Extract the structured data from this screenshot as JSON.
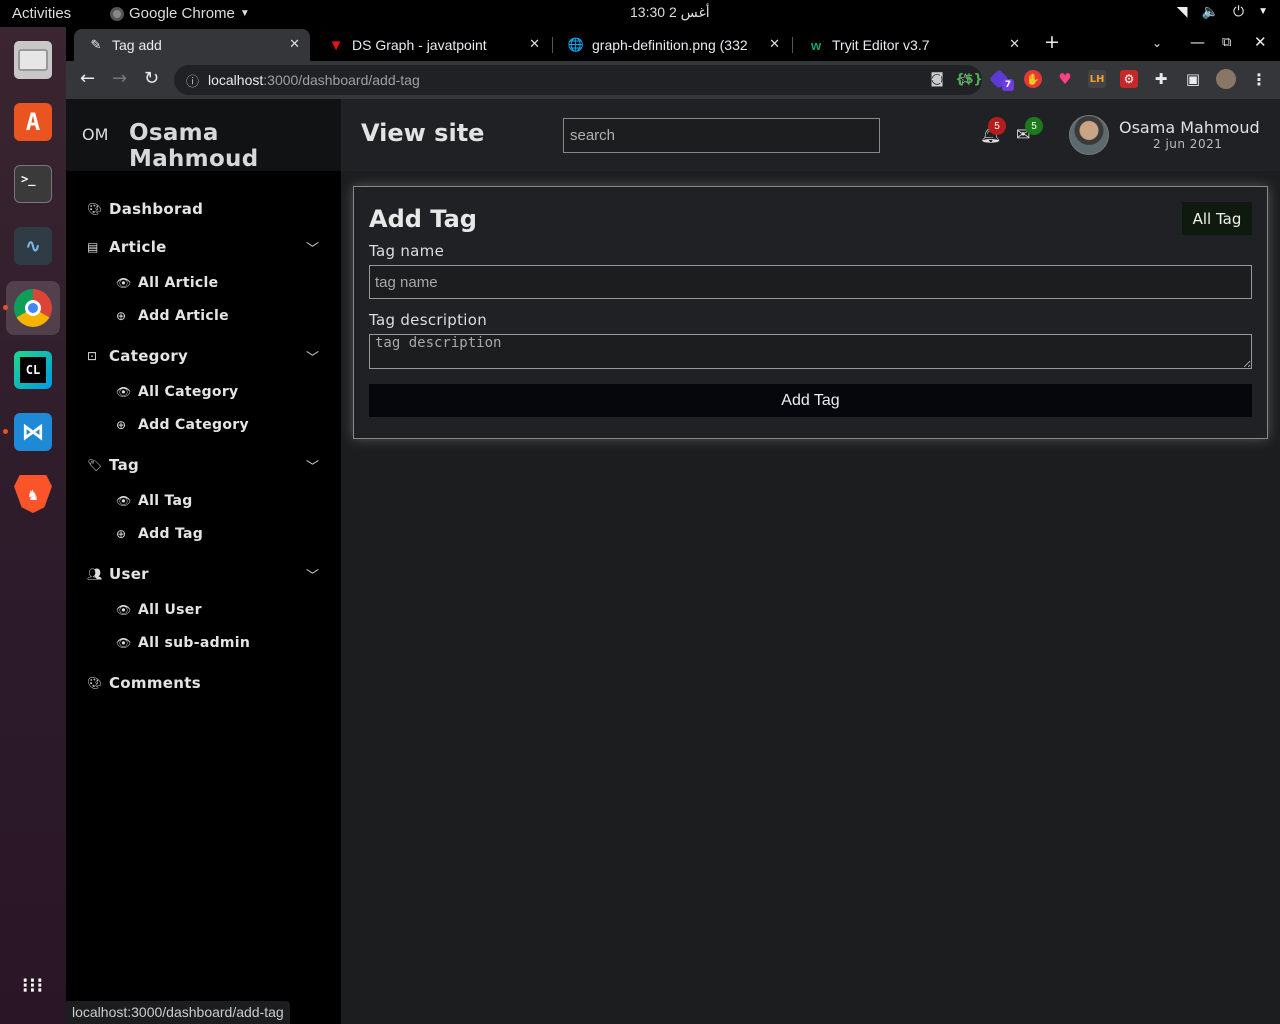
{
  "os": {
    "activities": "Activities",
    "app_name": "Google Chrome",
    "clock": "13:30  أغس 2"
  },
  "dock": {
    "items": [
      "files-icon",
      "software-center-icon",
      "terminal-icon",
      "system-monitor-icon",
      "chrome-icon",
      "clion-icon",
      "vscode-icon",
      "brave-icon",
      "app-grid-icon"
    ]
  },
  "browser": {
    "tabs": [
      {
        "title": "Tag add",
        "active": true
      },
      {
        "title": "DS Graph - javatpoint",
        "active": false
      },
      {
        "title": "graph-definition.png (332",
        "active": false
      },
      {
        "title": "Tryit Editor v3.7",
        "active": false
      }
    ],
    "url_host": "localhost",
    "url_path": ":3000/dashboard/add-tag",
    "status_url": "localhost:3000/dashboard/add-tag",
    "extension_badge": "7"
  },
  "header": {
    "initials": "OM",
    "brand_name": "Osama Mahmoud",
    "view_site": "View site",
    "search_placeholder": "search",
    "notifications_count": "5",
    "messages_count": "5",
    "user_name": "Osama Mahmoud",
    "user_date": "2 jun 2021"
  },
  "sidebar": {
    "dashboard": "Dashborad",
    "article": "Article",
    "all_article": "All Article",
    "add_article": "Add Article",
    "category": "Category",
    "all_category": "All Category",
    "add_category": "Add Category",
    "tag": "Tag",
    "all_tag": "All Tag",
    "add_tag": "Add Tag",
    "user": "User",
    "all_user": "All User",
    "all_sub_admin": "All sub-admin",
    "comments": "Comments"
  },
  "form": {
    "title": "Add Tag",
    "all_tag_button": "All Tag",
    "tag_name_label": "Tag name",
    "tag_name_placeholder": "tag name",
    "tag_name_value": "",
    "tag_description_label": "Tag description",
    "tag_description_placeholder": "tag description",
    "tag_description_value": "",
    "submit_label": "Add Tag"
  }
}
